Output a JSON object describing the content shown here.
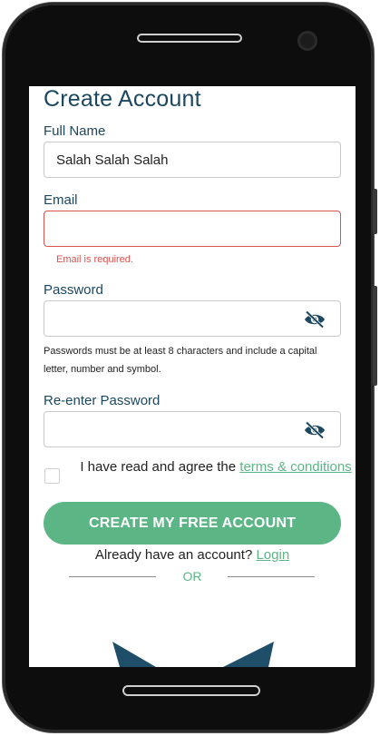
{
  "form": {
    "title": "Create Account",
    "full_name": {
      "label": "Full Name",
      "value": "Salah Salah Salah"
    },
    "email": {
      "label": "Email",
      "value": "",
      "error": "Email is required."
    },
    "password": {
      "label": "Password",
      "value": "",
      "hint": "Passwords must be at least 8 characters and include a capital letter, number and symbol."
    },
    "reenter": {
      "label": "Re-enter Password",
      "value": ""
    },
    "terms": {
      "prefix": "I have read and agree the ",
      "link": "terms & conditions",
      "checked": false
    },
    "submit_label": "CREATE MY FREE ACCOUNT",
    "login_prefix": "Already have an account? ",
    "login_link": "Login",
    "or_text": "OR"
  },
  "colors": {
    "primary": "#5bb585",
    "heading": "#1c4760",
    "error": "#d9534f",
    "decor": "#1f4f68"
  },
  "icons": {
    "password_toggle": "eye-slash-icon"
  }
}
